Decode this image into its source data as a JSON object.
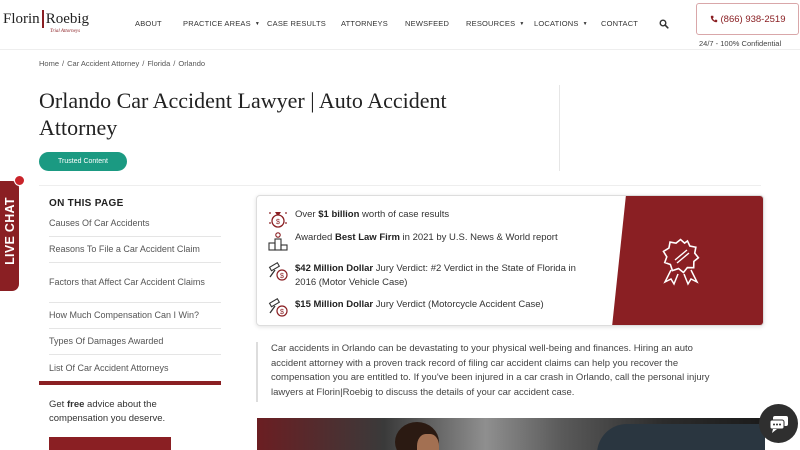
{
  "header": {
    "logo": {
      "main": "Florin|Roebig",
      "tagline": "Trial Attorneys"
    },
    "nav": [
      {
        "label": "ABOUT",
        "dropdown": false
      },
      {
        "label": "PRACTICE AREAS",
        "dropdown": true
      },
      {
        "label": "CASE RESULTS",
        "dropdown": false
      },
      {
        "label": "ATTORNEYS",
        "dropdown": false
      },
      {
        "label": "NEWSFEED",
        "dropdown": false
      },
      {
        "label": "RESOURCES",
        "dropdown": true
      },
      {
        "label": "LOCATIONS",
        "dropdown": true
      },
      {
        "label": "CONTACT",
        "dropdown": false
      }
    ],
    "search_icon": "search-icon",
    "phone": "(866) 938-2519",
    "phone_sub": "24/7 - 100% Confidential"
  },
  "breadcrumb": [
    "Home",
    "Car Accident Attorney",
    "Florida",
    "Orlando"
  ],
  "page": {
    "title": "Orlando Car Accident Lawyer | Auto Accident Attorney",
    "badge": "Trusted Content"
  },
  "live_chat": {
    "label": "LIVE CHAT"
  },
  "toc": {
    "title": "ON THIS PAGE",
    "items": [
      "Causes Of Car Accidents",
      "Reasons To File a Car Accident Claim",
      "Factors that Affect Car Accident Claims",
      "How Much Compensation Can I Win?",
      "Types Of Damages Awarded",
      "List Of Car Accident Attorneys"
    ]
  },
  "advice": {
    "pre": "Get ",
    "bold": "free",
    "post": " advice about the compensation you deserve."
  },
  "achievements": [
    {
      "pre": "Over ",
      "bold": "$1 billion",
      "post": " worth of case results",
      "icon": "money-bag-icon"
    },
    {
      "pre": "Awarded ",
      "bold": "Best Law Firm",
      "post": " in 2021 by U.S. News & World report",
      "icon": "award-podium-icon"
    },
    {
      "pre": "",
      "bold": "$42 Million Dollar",
      "post": " Jury Verdict: #2 Verdict in the State of Florida in 2016 (Motor Vehicle Case)",
      "icon": "gavel-dollar-icon"
    },
    {
      "pre": "",
      "bold": "$15 Million Dollar",
      "post": " Jury Verdict (Motorcycle Accident Case)",
      "icon": "gavel-dollar-icon"
    }
  ],
  "intro": "Car accidents in Orlando can be devastating to your physical well-being and finances. Hiring an auto accident attorney with a proven track record of filing car accident claims can help you recover the compensation you are entitled to. If you've been injured in a car crash in Orlando, call the personal injury lawyers at Florin|Roebig to discuss the details of your car accident case.",
  "colors": {
    "brand": "#8a1f23",
    "badge": "#1b9a82",
    "text": "#333333"
  }
}
